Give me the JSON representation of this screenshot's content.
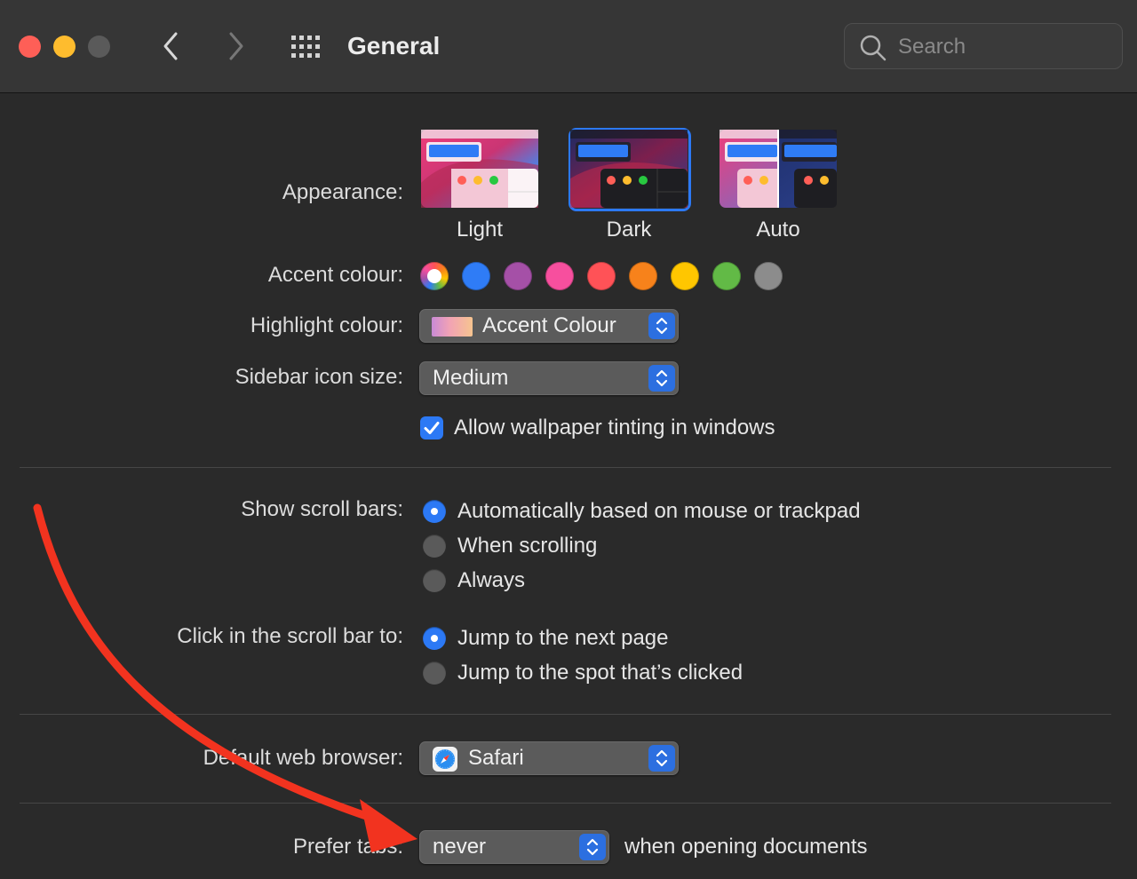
{
  "window": {
    "title": "General"
  },
  "search": {
    "placeholder": "Search"
  },
  "appearance": {
    "label": "Appearance:",
    "options": [
      {
        "caption": "Light",
        "selected": false
      },
      {
        "caption": "Dark",
        "selected": true
      },
      {
        "caption": "Auto",
        "selected": false
      }
    ]
  },
  "accent": {
    "label": "Accent colour:",
    "colors": [
      "multicolor",
      "#2f7cf6",
      "#a550a7",
      "#f74f9e",
      "#ff5257",
      "#f7821b",
      "#ffc600",
      "#62ba46",
      "#8c8c8c"
    ],
    "selected_index": 0
  },
  "highlight": {
    "label": "Highlight colour:",
    "value": "Accent Colour"
  },
  "sidebar_icon_size": {
    "label": "Sidebar icon size:",
    "value": "Medium"
  },
  "wallpaper_tinting": {
    "label": "Allow wallpaper tinting in windows",
    "checked": true
  },
  "scroll_bars": {
    "label": "Show scroll bars:",
    "options": [
      {
        "label": "Automatically based on mouse or trackpad",
        "selected": true
      },
      {
        "label": "When scrolling",
        "selected": false
      },
      {
        "label": "Always",
        "selected": false
      }
    ]
  },
  "scroll_click": {
    "label": "Click in the scroll bar to:",
    "options": [
      {
        "label": "Jump to the next page",
        "selected": true
      },
      {
        "label": "Jump to the spot that’s clicked",
        "selected": false
      }
    ]
  },
  "default_browser": {
    "label": "Default web browser:",
    "value": "Safari"
  },
  "prefer_tabs": {
    "label": "Prefer tabs:",
    "value": "never",
    "suffix": "when opening documents"
  },
  "colors": {
    "accent_blue": "#2c79f5",
    "background": "#2a2a2a",
    "annotation_red": "#f2331f"
  }
}
